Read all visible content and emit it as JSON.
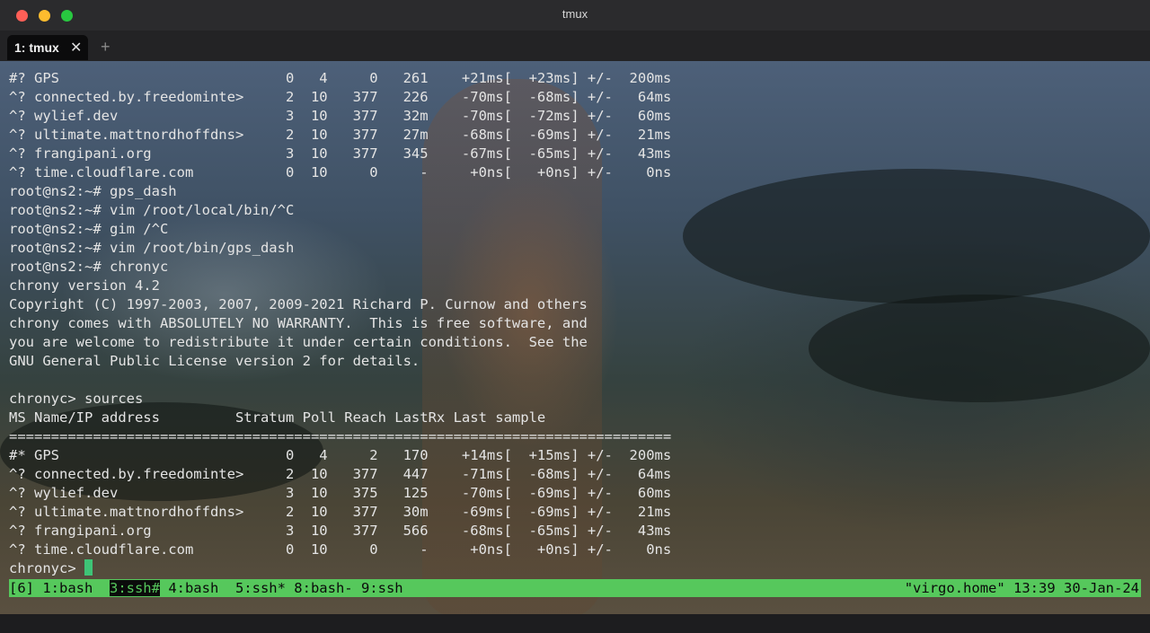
{
  "window": {
    "title": "tmux"
  },
  "tabbar": {
    "tab_label": "1: tmux",
    "close_glyph": "✕",
    "add_glyph": "+"
  },
  "terminal": {
    "lines": [
      "#? GPS                           0   4     0   261    +21ms[  +23ms] +/-  200ms",
      "^? connected.by.freedominte>     2  10   377   226    -70ms[  -68ms] +/-   64ms",
      "^? wylief.dev                    3  10   377   32m    -70ms[  -72ms] +/-   60ms",
      "^? ultimate.mattnordhoffdns>     2  10   377   27m    -68ms[  -69ms] +/-   21ms",
      "^? frangipani.org                3  10   377   345    -67ms[  -65ms] +/-   43ms",
      "^? time.cloudflare.com           0  10     0     -     +0ns[   +0ns] +/-    0ns",
      "root@ns2:~# gps_dash",
      "root@ns2:~# vim /root/local/bin/^C",
      "root@ns2:~# gim /^C",
      "root@ns2:~# vim /root/bin/gps_dash",
      "root@ns2:~# chronyc",
      "chrony version 4.2",
      "Copyright (C) 1997-2003, 2007, 2009-2021 Richard P. Curnow and others",
      "chrony comes with ABSOLUTELY NO WARRANTY.  This is free software, and",
      "you are welcome to redistribute it under certain conditions.  See the",
      "GNU General Public License version 2 for details.",
      "",
      "chronyc> sources",
      "MS Name/IP address         Stratum Poll Reach LastRx Last sample",
      "===============================================================================",
      "#* GPS                           0   4     2   170    +14ms[  +15ms] +/-  200ms",
      "^? connected.by.freedominte>     2  10   377   447    -71ms[  -68ms] +/-   64ms",
      "^? wylief.dev                    3  10   375   125    -70ms[  -69ms] +/-   60ms",
      "^? ultimate.mattnordhoffdns>     2  10   377   30m    -69ms[  -69ms] +/-   21ms",
      "^? frangipani.org                3  10   377   566    -68ms[  -65ms] +/-   43ms",
      "^? time.cloudflare.com           0  10     0     -     +0ns[   +0ns] +/-    0ns"
    ],
    "prompt": "chronyc> "
  },
  "statusbar": {
    "session": "[6] ",
    "win_1": "1:bash  ",
    "win_3_current": "3:ssh#",
    "rest": " 4:bash  5:ssh* 8:bash- 9:ssh",
    "right": "\"virgo.home\" 13:39 30-Jan-24",
    "bg_color": "#56c85c"
  }
}
